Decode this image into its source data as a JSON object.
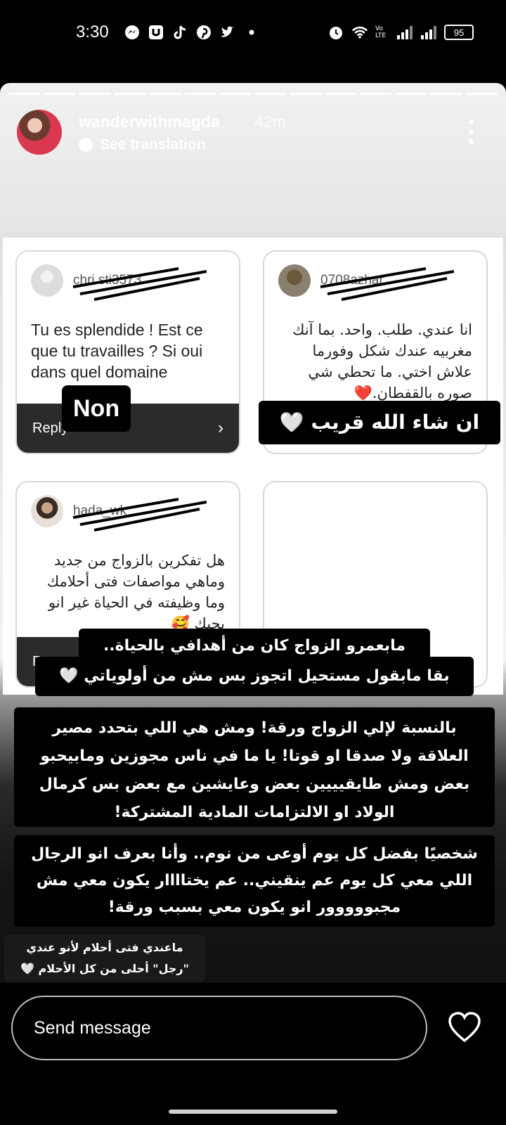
{
  "status_bar": {
    "time": "3:30",
    "network_label": "Vo LTE",
    "battery": "95",
    "app_icons": [
      "messenger-icon",
      "u-app-icon",
      "tiktok-icon",
      "pinterest-icon",
      "twitter-icon",
      "dot-icon"
    ],
    "system_icons": [
      "alarm-icon",
      "wifi-icon",
      "signal-icon",
      "signal-icon",
      "battery-icon"
    ]
  },
  "story": {
    "username": "wanderwithmagda",
    "time_ago": "42m",
    "see_translation": "See translation",
    "progress_segments": 14
  },
  "cards": [
    {
      "user": "chri.sti3573",
      "question": "Tu es splendide ! Est ce que tu travailles ? Si oui dans quel domaine",
      "reply_label": "Reply",
      "sticker": "Non"
    },
    {
      "user": "0708azhar",
      "question": "انا عندي. طلب. واحد. بما آنك مغربيه عندك شكل وفورما علاش اختي. ما تحطي شي صوره بالقفطان.❤️",
      "sticker": "ان شاء الله قريب 🤍"
    },
    {
      "user": "hada_wk",
      "question": "هل تفكرين بالزواج من جديد وماهي مواصفات فتى أحلامك وما وظيفته في الحياة غير انو يحبك 🥰",
      "reply_label": "R"
    },
    {
      "user": "",
      "question": ""
    }
  ],
  "overlay_texts": {
    "answer_line1": "مابعمرو الزواج كان من أهدافي بالحياة..",
    "answer_line2": "بقا مابقول مستحيل اتجوز بس مش من أولوياتي 🤍",
    "paragraph1": "بالنسبة لإلي الزواج ورقة! ومش هي اللي بتحدد مصير العلاقة ولا صدقا او قوتا! يا ما في ناس مجوزين ومابيحبو بعض ومش طايقيييين بعض وعايشين مع بعض بس كرمال الولاد او الالتزامات المادية المشتركة!",
    "paragraph2": "شخصيًا بفضل كل يوم أوعى من نوم.. وأنا بعرف انو الرجال اللي معي كل يوم عم ينقيني.. عم يختاااار يكون معي مش مجبووووور انو يكون معي بسبب ورقة!",
    "small_line1": "ماعندي فتى أحلام لأنو عندي",
    "small_line2": "\"رجل\" أحلى من كل الأحلام 🤍"
  },
  "message_bar": {
    "placeholder": "Send message"
  }
}
